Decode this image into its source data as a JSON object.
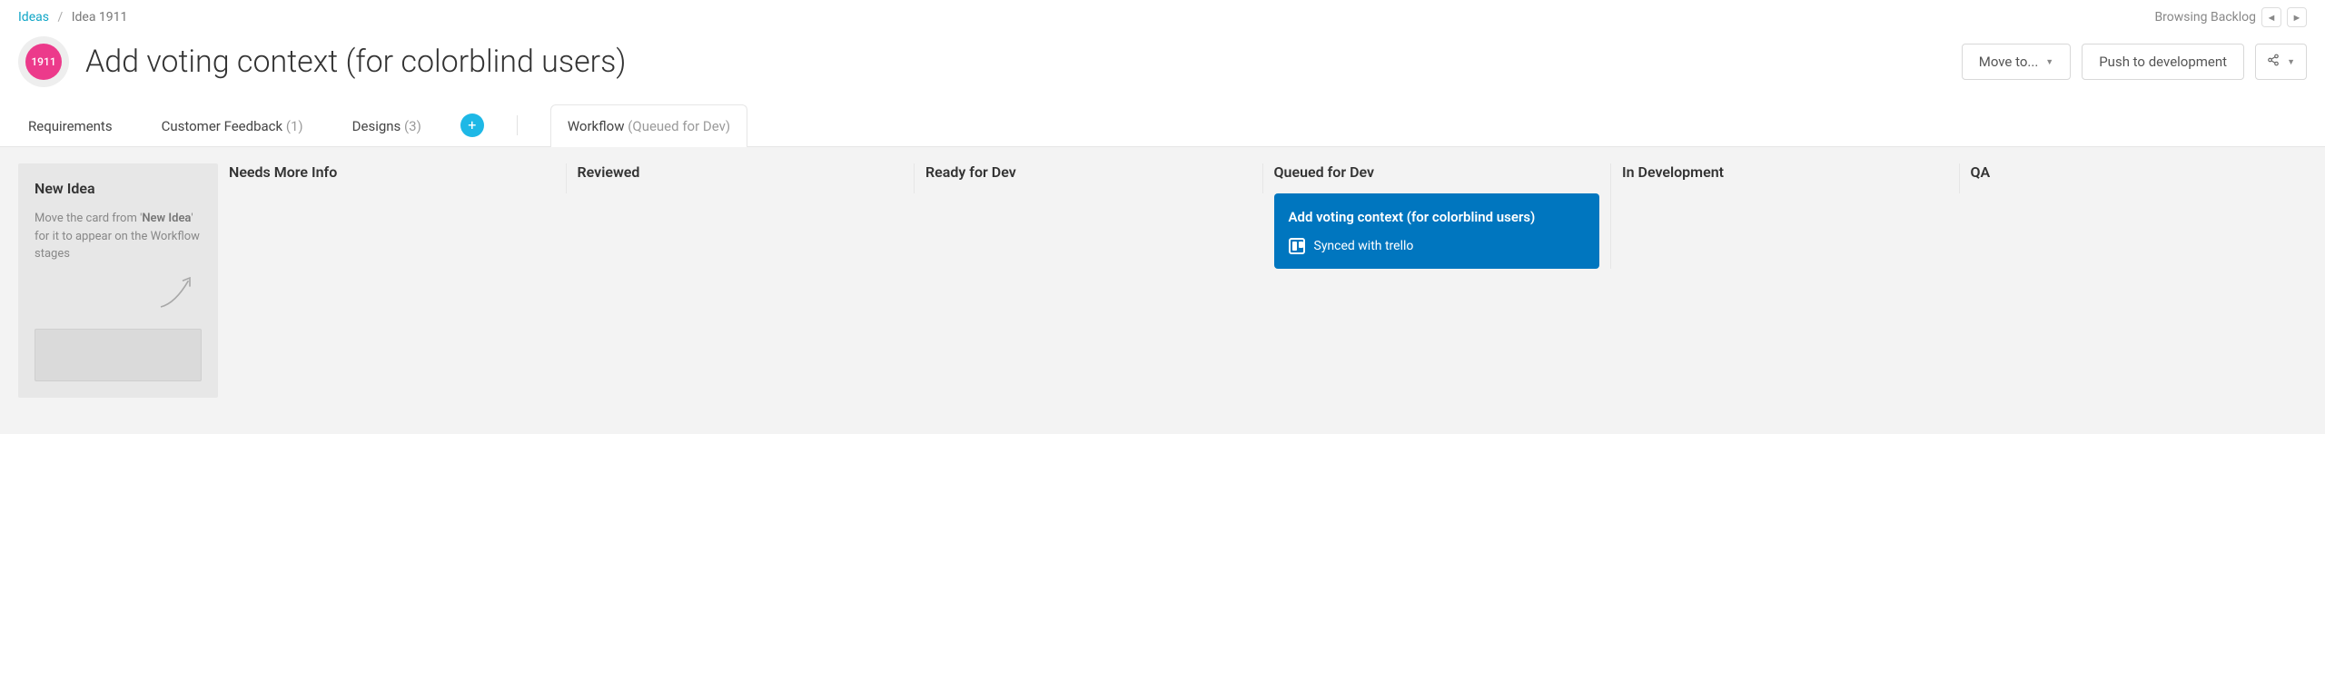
{
  "breadcrumb": {
    "root": "Ideas",
    "current": "Idea 1911"
  },
  "browsing": {
    "label": "Browsing Backlog"
  },
  "idea": {
    "badge": "1911",
    "title": "Add voting context (for colorblind users)"
  },
  "actions": {
    "move_to": "Move to...",
    "push_dev": "Push to development"
  },
  "tabs": {
    "requirements": "Requirements",
    "feedback_label": "Customer Feedback",
    "feedback_count": "(1)",
    "designs_label": "Designs",
    "designs_count": "(3)",
    "workflow_label": "Workflow",
    "workflow_state": "(Queued for Dev)"
  },
  "board": {
    "new_idea": {
      "header": "New Idea",
      "desc_pre": "Move the card from '",
      "desc_bold": "New Idea",
      "desc_post": "' for it to appear on the Workflow stages"
    },
    "columns": [
      {
        "header": "Needs More Info"
      },
      {
        "header": "Reviewed"
      },
      {
        "header": "Ready for Dev"
      },
      {
        "header": "Queued for Dev"
      },
      {
        "header": "In Development"
      },
      {
        "header": "QA"
      }
    ],
    "card": {
      "title": "Add voting context (for colorblind users)",
      "sync": "Synced with trello"
    }
  }
}
